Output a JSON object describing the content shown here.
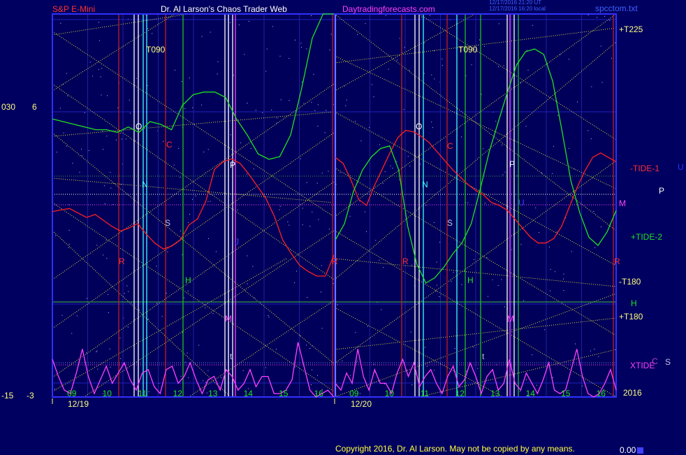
{
  "header": {
    "symbol": "S&P E-Mini",
    "title": "Dr. Al Larson's Chaos Trader Web",
    "site": "Daytradingforecasts.com",
    "timestamp1": "12/17/2016 21:20 UT",
    "timestamp2": "12/17/2016 16:20 local",
    "filename": "spcctom.txt"
  },
  "left_axis": {
    "labels": [
      {
        "a": "030",
        "b": "6"
      },
      {
        "a": "-15",
        "b": "-3"
      }
    ]
  },
  "right_labels": {
    "t225": "+T225",
    "tide1": "-TIDE-1",
    "u_char": "U",
    "p_char": "P",
    "m_char": "M",
    "tide2": "+TIDE-2",
    "t180neg": "-T180",
    "h_char": "H",
    "t180pos": "+T180",
    "xtide": "XTIDE",
    "c_char": "C",
    "s_char": "S",
    "year": "2016"
  },
  "day_labels": {
    "day1": "12/19",
    "day2": "12/20"
  },
  "planet_labels": {
    "t090": "T090",
    "o": "O",
    "c": "C",
    "p": "P",
    "n": "N",
    "s": "S",
    "h": "H",
    "m": "M",
    "r": "R",
    "t": "t",
    "j": "J",
    "u": "U"
  },
  "footer": {
    "copyright": "Copyright 2016, Dr. Al Larson. May not be copied by any means.",
    "readout": "0.00"
  },
  "colors": {
    "background": "#000060",
    "plot_bg": "#00005a",
    "tide1": "#ff2020",
    "tide2": "#20e020",
    "xtide": "#ff40ff",
    "grid_yellow": "#e0e040",
    "axis_blue": "#3030ff",
    "label_yellow": "#ffff80",
    "header_red": "#ff3030",
    "header_magenta": "#ff40ff",
    "vline_white": "#ffffff",
    "vline_cyan": "#40ffff",
    "vline_green": "#20c020",
    "vline_red": "#c02020",
    "vline_magenta": "#ff40ff"
  },
  "chart_data": {
    "type": "line",
    "x_hour_labels": [
      "09",
      "10",
      "11",
      "12",
      "13",
      "14",
      "15",
      "16",
      "09",
      "10",
      "11",
      "12",
      "13",
      "14",
      "15",
      "16"
    ],
    "y_axis_ticks": [
      "030",
      "-15"
    ],
    "y2_axis_ticks": [
      "6",
      "-3"
    ],
    "series": [
      {
        "name": "TIDE-1",
        "values": [
          0.43,
          0.44,
          0.45,
          0.42,
          0.39,
          0.41,
          0.37,
          0.33,
          0.3,
          0.32,
          0.35,
          0.28,
          0.22,
          0.18,
          0.2,
          0.24,
          0.34,
          0.38,
          0.5,
          0.71,
          0.76,
          0.78,
          0.75,
          0.68,
          0.6,
          0.52,
          0.4,
          0.24,
          0.15,
          0.07,
          0.03,
          0.0,
          0.0,
          0.14,
          0.79,
          0.75,
          0.64,
          0.51,
          0.47,
          0.6,
          0.71,
          0.82,
          0.92,
          0.97,
          0.96,
          0.93,
          0.89,
          0.83,
          0.77,
          0.71,
          0.66,
          0.61,
          0.57,
          0.54,
          0.49,
          0.47,
          0.44,
          0.38,
          0.32,
          0.26,
          0.22,
          0.22,
          0.25,
          0.33,
          0.46,
          0.59,
          0.7,
          0.79,
          0.82,
          0.79,
          0.76
        ]
      },
      {
        "name": "TIDE-2",
        "values": [
          0.61,
          0.6,
          0.59,
          0.58,
          0.57,
          0.57,
          0.56,
          0.58,
          0.56,
          0.6,
          0.59,
          0.57,
          0.66,
          0.7,
          0.71,
          0.71,
          0.69,
          0.61,
          0.55,
          0.48,
          0.46,
          0.47,
          0.55,
          0.72,
          0.91,
          1.0,
          1.0,
          0.16,
          0.22,
          0.34,
          0.42,
          0.47,
          0.5,
          0.51,
          0.42,
          0.21,
          0.07,
          0.0,
          0.02,
          0.06,
          0.11,
          0.15,
          0.22,
          0.35,
          0.49,
          0.6,
          0.71,
          0.81,
          0.86,
          0.87,
          0.85,
          0.75,
          0.57,
          0.38,
          0.26,
          0.17,
          0.14,
          0.19,
          0.27
        ]
      },
      {
        "name": "XTIDE",
        "values": [
          0.55,
          0.3,
          0.1,
          0.05,
          0.35,
          0.7,
          0.3,
          0.05,
          0.25,
          0.45,
          0.2,
          0.35,
          0.5,
          0.25,
          0.1,
          0.35,
          0.4,
          0.15,
          0.05,
          0.4,
          0.45,
          0.2,
          0.3,
          0.5,
          0.25,
          0.05,
          0.25,
          0.3,
          0.1,
          0.4,
          0.3,
          0.1,
          0.2,
          0.4,
          0.15,
          0.3,
          0.3,
          0.05,
          0.05,
          0.1,
          0.25,
          0.8,
          0.45,
          0.1,
          0.0,
          0.05,
          0.1,
          0.0,
          0.2,
          0.1,
          0.35,
          0.2,
          0.7,
          0.3,
          0.1,
          0.4,
          0.2,
          0.2,
          0.05,
          0.35,
          0.55,
          0.3,
          0.5,
          0.15,
          0.3,
          0.4,
          0.2,
          0.05,
          0.3,
          0.45,
          0.15,
          0.25,
          0.5,
          0.3,
          0.05,
          0.3,
          0.4,
          0.1,
          0.2,
          0.55,
          0.2,
          0.1,
          0.35,
          0.2,
          0.05,
          0.25,
          0.5,
          0.1,
          0.05,
          0.1,
          0.4,
          0.7,
          0.3,
          0.05,
          0.0,
          0.05,
          0.2,
          0.4,
          0.1
        ]
      }
    ],
    "grid": true
  }
}
